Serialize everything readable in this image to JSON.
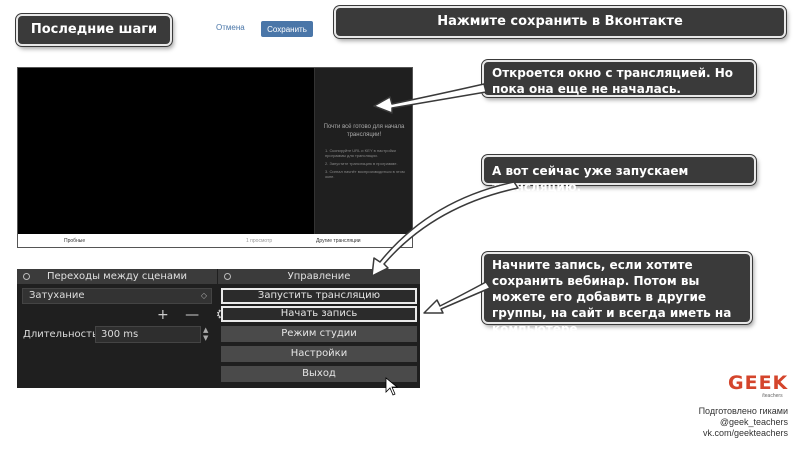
{
  "slide": {
    "title": "Последние шаги",
    "top_instruction": "Нажмите сохранить в Вконтакте",
    "callouts": [
      "Откроется окно с трансляцией. Но пока она еще не началась.",
      "А вот сейчас уже запускаем трансляцию.",
      "Начните запись, если хотите сохранить вебинар. Потом вы можете его добавить в другие группы, на сайт и всегда иметь на компьютере"
    ]
  },
  "vk_dialog": {
    "cancel_label": "Отмена",
    "save_label": "Сохранить"
  },
  "vk_window": {
    "side_title": "Почти всё готово для начала трансляции!",
    "steps": [
      "1. Скопируйте URL и KEY в настройки программы для трансляции.",
      "2. Запустите трансляцию в программе.",
      "3. Сигнал начнёт воспроизводиться в этом окне."
    ],
    "footer_left": "Пробные",
    "footer_mid": "1 просмотр",
    "footer_right": "Другие трансляции"
  },
  "obs": {
    "transitions_header": "Переходы между сценами",
    "controls_header": "Управление",
    "transition_value": "Затухание",
    "tools": "+ — ⚙",
    "duration_label": "Длительность",
    "duration_value": "300 ms",
    "buttons": {
      "start_stream": "Запустить трансляцию",
      "start_record": "Начать запись",
      "studio_mode": "Режим студии",
      "settings": "Настройки",
      "exit": "Выход"
    }
  },
  "branding": {
    "logo": "GEEK",
    "logo_sub": "/teachers",
    "credits": [
      "Подготовлено гиками",
      "@geek_teachers",
      "vk.com/geekteachers"
    ],
    "accent_color": "#d4452c"
  }
}
